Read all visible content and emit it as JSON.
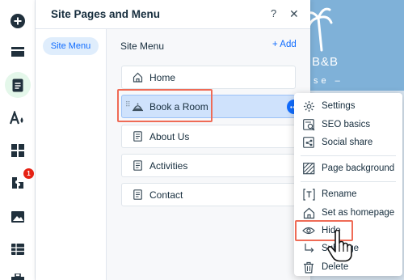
{
  "panel": {
    "title": "Site Pages and Menu",
    "help_label": "?",
    "close_label": "✕"
  },
  "left_tabs": [
    {
      "label": "Site Menu",
      "active": true
    }
  ],
  "menu": {
    "title": "Site Menu",
    "add_label": "+ Add",
    "pages": [
      {
        "label": "Home",
        "icon": "home-icon"
      },
      {
        "label": "Book a Room",
        "icon": "bell-icon",
        "selected": true
      },
      {
        "label": "About Us",
        "icon": "page-icon"
      },
      {
        "label": "Activities",
        "icon": "page-icon"
      },
      {
        "label": "Contact",
        "icon": "page-icon"
      }
    ]
  },
  "toolbar": {
    "badge_count": "1",
    "items": [
      "add-icon",
      "sections-icon",
      "pages-icon",
      "design-icon",
      "apps-icon",
      "app-market-icon",
      "media-icon",
      "table-icon",
      "portfolio-icon"
    ]
  },
  "context_menu": {
    "items": [
      {
        "label": "Settings",
        "icon": "gear-icon"
      },
      {
        "label": "SEO basics",
        "icon": "seo-icon"
      },
      {
        "label": "Social share",
        "icon": "share-icon"
      },
      {
        "label": "Page background",
        "icon": "background-icon"
      },
      {
        "label": "Rename",
        "icon": "rename-icon"
      },
      {
        "label": "Set as homepage",
        "icon": "home-icon"
      },
      {
        "label": "Hide",
        "icon": "eye-icon"
      },
      {
        "label": "Subpage",
        "icon": "subpage-icon"
      },
      {
        "label": "Delete",
        "icon": "trash-icon"
      }
    ]
  },
  "preview": {
    "title": "B&B",
    "subtitle": "se  –"
  },
  "colors": {
    "accent": "#116dff",
    "highlight": "#ef6b56",
    "badge": "#e62214",
    "active_tab_bg": "#dfedfc",
    "selected_row_bg": "#cfe2fc"
  }
}
